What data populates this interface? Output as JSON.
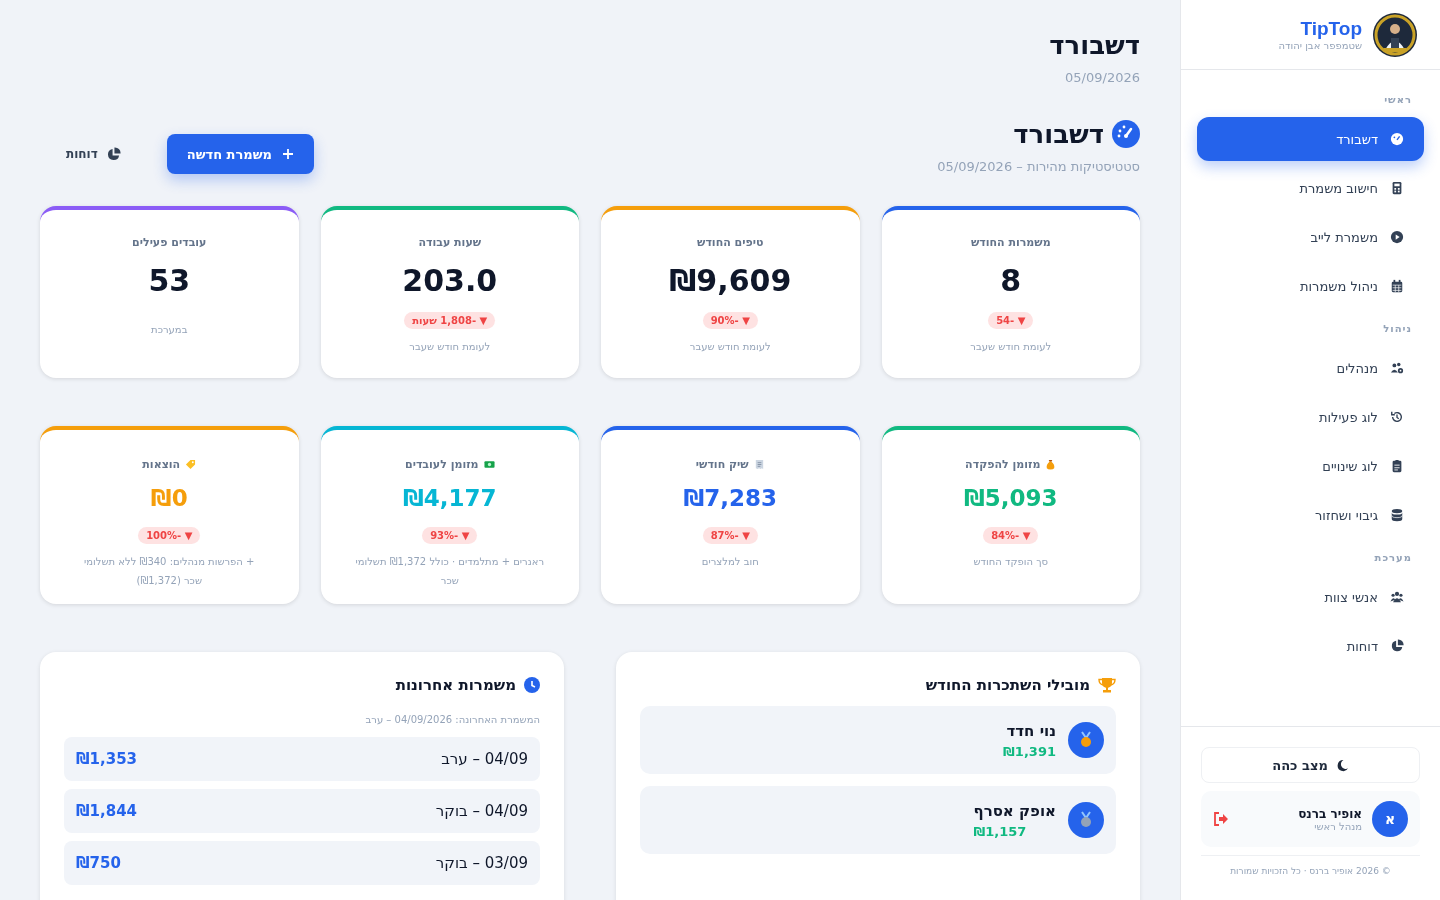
{
  "header": {
    "title": "דשבורד",
    "date": "05/09/2026"
  },
  "section": {
    "title": "דשבורד",
    "subtitle": "סטטיסטיקות מהירות – 05/09/2026"
  },
  "actions": {
    "primary": "משמרת חדשה",
    "link": "דוחות"
  },
  "stats": [
    {
      "label": "משמרות החודש",
      "value": "8",
      "color": "#2563eb",
      "change": {
        "arrow": "▼",
        "text": "-54"
      },
      "note": "לעומת חודש שעבר"
    },
    {
      "label": "טיפים החודש",
      "value": "₪9,609",
      "color": "#f59e0b",
      "change": {
        "arrow": "▼",
        "text": "-90%"
      },
      "note": "לעומת חודש שעבר"
    },
    {
      "label": "שעות עבודה",
      "value": "203.0",
      "color": "#10b981",
      "change": {
        "arrow": "▼",
        "text": "-1,808 שעות"
      },
      "note": "לעומת חודש שעבר"
    },
    {
      "label": "עובדים פעילים",
      "value": "53",
      "color": "#8b5cf6",
      "note": "במערכת"
    }
  ],
  "finance": [
    {
      "label": "מזומן להפקדה",
      "value": "₪5,093",
      "color": "#10b981",
      "change": {
        "arrow": "▼",
        "text": "-84%"
      },
      "note": "סך הופקד החודש"
    },
    {
      "label": "שיק חודשי",
      "value": "₪7,283",
      "color": "#2563eb",
      "change": {
        "arrow": "▼",
        "text": "-87%"
      },
      "note": "חוב למלצרים"
    },
    {
      "label": "מזומן לעובדים",
      "value": "₪4,177",
      "color": "#06b6d4",
      "change": {
        "arrow": "▼",
        "text": "-93%"
      },
      "note": "ראנרים + מתלמדים · כולל ₪1,372 תשלומי שכר"
    },
    {
      "label": "הוצאות",
      "value": "₪0",
      "color": "#f59e0b",
      "change": {
        "arrow": "▼",
        "text": "-100%"
      },
      "note": "+ הפרשות מנהלים: ₪340 ללא תשלומי שכר (₪1,372)"
    }
  ],
  "leaders": {
    "title": "מובילי השתכרות החודש",
    "items": [
      {
        "name": "נוי חדד",
        "amount": "₪1,391",
        "color": "#f59e0b"
      },
      {
        "name": "אופק אסרף",
        "amount": "₪1,157",
        "color": "#94a3b8"
      }
    ]
  },
  "recent": {
    "title": "משמרות אחרונות",
    "note": "המשמרת האחרונה: 04/09/2026 – ערב",
    "items": [
      {
        "label": "04/09 – ערב",
        "amount": "₪1,353"
      },
      {
        "label": "04/09 – בוקר",
        "amount": "₪1,844"
      },
      {
        "label": "03/09 – בוקר",
        "amount": "₪750"
      }
    ]
  },
  "sidebar": {
    "brand": "TipTop",
    "subtitle": "שטמפפר אבן יהודה",
    "groups": [
      {
        "title": "ראשי",
        "items": [
          {
            "label": "דשבורד",
            "selected": true
          },
          {
            "label": "חישוב משמרת",
            "selected": false
          },
          {
            "label": "משמרת לייב",
            "selected": false
          },
          {
            "label": "ניהול משמרות",
            "selected": false
          }
        ]
      },
      {
        "title": "ניהול",
        "items": [
          {
            "label": "מנהלים",
            "selected": false
          },
          {
            "label": "לוג פעילות",
            "selected": false
          },
          {
            "label": "לוג שינויים",
            "selected": false
          },
          {
            "label": "גיבוי ושחזור",
            "selected": false
          }
        ]
      },
      {
        "title": "מערכת",
        "items": [
          {
            "label": "אנשי צוות",
            "selected": false
          },
          {
            "label": "דוחות",
            "selected": false
          }
        ]
      }
    ],
    "dark_mode": "מצב כהה",
    "user": {
      "initial": "א",
      "name": "אופיר ברנס",
      "role": "מנהל ראשי"
    },
    "footer": "© 2026 אופיר ברנס · כל הזכויות שמורות"
  }
}
